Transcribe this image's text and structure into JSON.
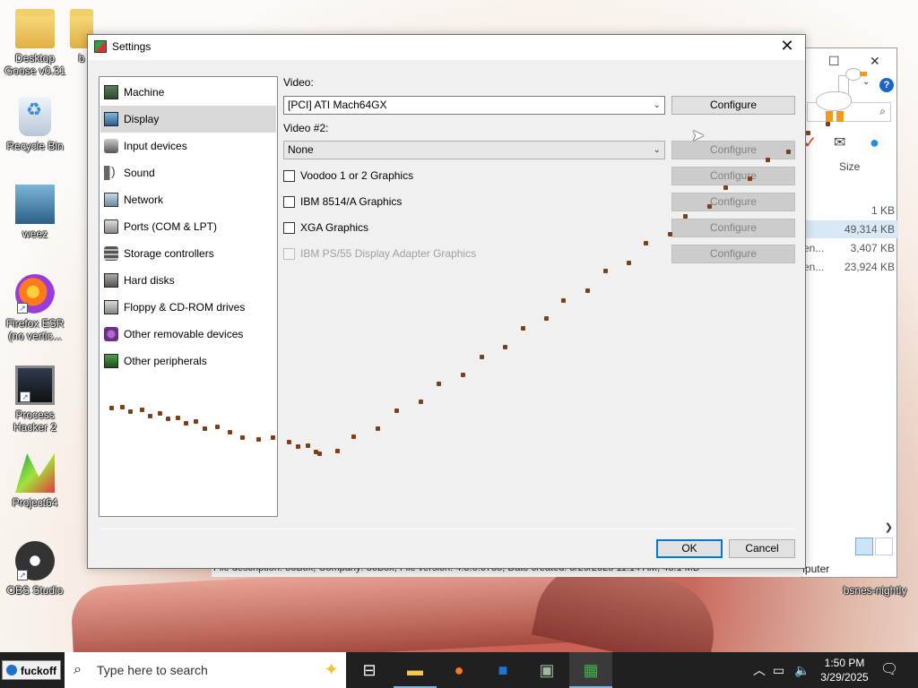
{
  "desktop": {
    "icons": [
      {
        "label": "Desktop Goose v0.31",
        "icon": "folder-icon"
      },
      {
        "label": "b",
        "icon": "folder-icon"
      },
      {
        "label": "Recycle Bin",
        "icon": "recycle-bin-icon"
      },
      {
        "label": "weez",
        "icon": "band-photo-icon"
      },
      {
        "label": "Firefox ESR (no vertic...",
        "icon": "firefox-icon"
      },
      {
        "label": "Process Hacker 2",
        "icon": "process-hacker-icon"
      },
      {
        "label": "Project64",
        "icon": "project64-icon"
      },
      {
        "label": "OBS Studio",
        "icon": "obs-icon"
      },
      {
        "label": "bsnes-nightly",
        "icon": "bsnes-icon"
      }
    ]
  },
  "explorer_bg": {
    "column_size": "Size",
    "rows": [
      {
        "name": "",
        "size": "1 KB"
      },
      {
        "name": "",
        "size": "49,314 KB"
      },
      {
        "name": "en...",
        "size": "3,407 KB"
      },
      {
        "name": "en...",
        "size": "23,924 KB"
      }
    ],
    "status_text": "File description: 86Box, Company: 86Box, File version: 4.3.0.6785, Date created: 3/29/2025 11:14 AM, 48.1 MB",
    "computer_label": "Computer"
  },
  "dialog": {
    "title": "Settings",
    "nav": [
      {
        "label": "Machine",
        "icon": "machine-icon"
      },
      {
        "label": "Display",
        "icon": "display-icon",
        "selected": true
      },
      {
        "label": "Input devices",
        "icon": "input-devices-icon"
      },
      {
        "label": "Sound",
        "icon": "sound-icon"
      },
      {
        "label": "Network",
        "icon": "network-icon"
      },
      {
        "label": "Ports (COM & LPT)",
        "icon": "ports-icon"
      },
      {
        "label": "Storage controllers",
        "icon": "storage-controllers-icon"
      },
      {
        "label": "Hard disks",
        "icon": "hard-disk-icon"
      },
      {
        "label": "Floppy & CD-ROM drives",
        "icon": "floppy-icon"
      },
      {
        "label": "Other removable devices",
        "icon": "removable-devices-icon"
      },
      {
        "label": "Other peripherals",
        "icon": "peripherals-icon"
      }
    ],
    "display": {
      "video_label": "Video:",
      "video_value": "[PCI] ATI Mach64GX",
      "video2_label": "Video #2:",
      "video2_value": "None",
      "configure_label": "Configure",
      "checkboxes": [
        {
          "label": "Voodoo 1 or 2 Graphics",
          "checked": false,
          "enabled": true
        },
        {
          "label": "IBM 8514/A Graphics",
          "checked": false,
          "enabled": true
        },
        {
          "label": "XGA Graphics",
          "checked": false,
          "enabled": true
        },
        {
          "label": "IBM PS/55 Display Adapter Graphics",
          "checked": false,
          "enabled": false
        }
      ]
    },
    "ok_label": "OK",
    "cancel_label": "Cancel"
  },
  "taskbar": {
    "start_label": "fuckoff",
    "search_placeholder": "Type here to search",
    "apps": [
      "task-view-icon",
      "file-explorer-icon",
      "firefox-icon",
      "outlook-icon",
      "process-hacker-icon",
      "86box-icon"
    ],
    "time": "1:50 PM",
    "date": "3/29/2025"
  },
  "colors": {
    "accent": "#0078d7",
    "mud": "#7b3f1c",
    "taskbar": "#202020"
  }
}
